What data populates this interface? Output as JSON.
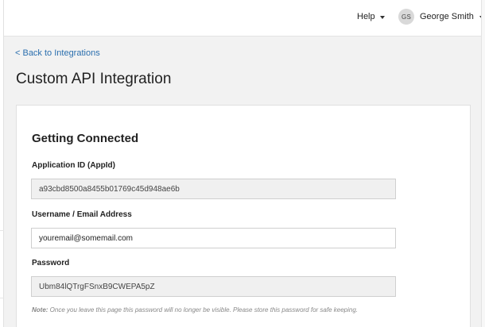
{
  "header": {
    "help_label": "Help",
    "user": {
      "initials": "GS",
      "name": "George Smith"
    }
  },
  "nav": {
    "back_link": "< Back to Integrations"
  },
  "page": {
    "title": "Custom API Integration"
  },
  "card": {
    "title": "Getting Connected",
    "fields": {
      "app_id": {
        "label": "Application ID (AppId)",
        "value": "a93cbd8500a8455b01769c45d948ae6b"
      },
      "username": {
        "label": "Username / Email Address",
        "value": "youremail@somemail.com"
      },
      "password": {
        "label": "Password",
        "value": "Ubm84lQTrgFSnxB9CWEPA5pZ"
      }
    },
    "note": {
      "prefix": "Note:",
      "text": " Once you leave this page this password will no longer be visible. Please store this password for safe keeping."
    }
  },
  "colors": {
    "link": "#2b6fae",
    "background": "#f2f2f2",
    "readonly_field": "#f0f0f0"
  },
  "icons": [
    "caret-down-icon",
    "avatar"
  ]
}
